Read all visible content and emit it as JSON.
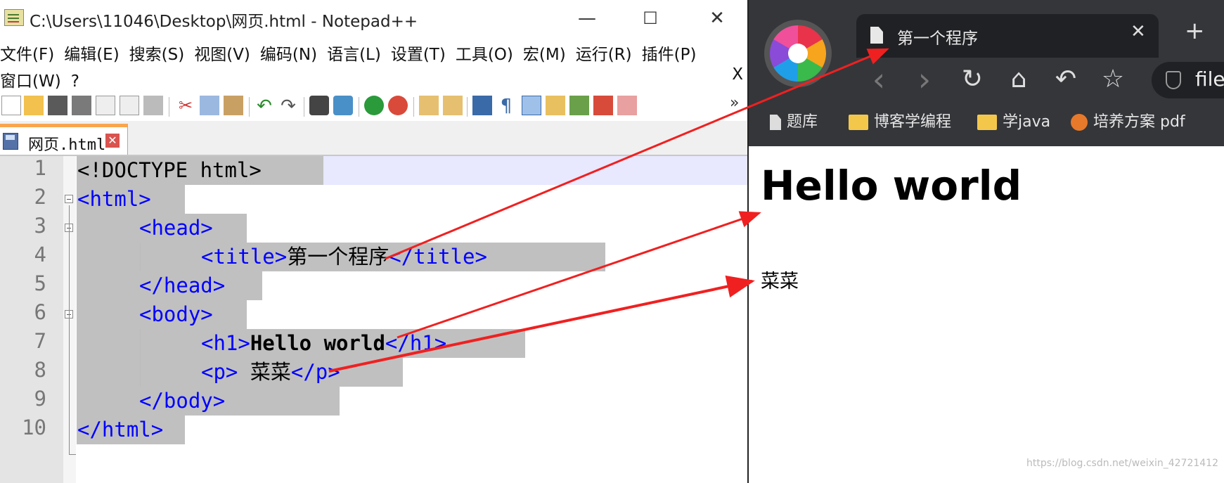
{
  "notepad": {
    "window_title": "C:\\Users\\11046\\Desktop\\网页.html - Notepad++",
    "window_controls": {
      "minimize": "—",
      "maximize": "☐",
      "close": "✕"
    },
    "menu_row1": [
      "文件(F)",
      "编辑(E)",
      "搜索(S)",
      "视图(V)",
      "编码(N)",
      "语言(L)",
      "设置(T)",
      "工具(O)",
      "宏(M)",
      "运行(R)",
      "插件(P)"
    ],
    "menu_row2": [
      "窗口(W)",
      "?"
    ],
    "menu_close": "X",
    "toolbar_overflow": "»",
    "tab": {
      "label": "网页.html",
      "close": "✕"
    },
    "line_numbers": [
      "1",
      "2",
      "3",
      "4",
      "5",
      "6",
      "7",
      "8",
      "9",
      "10"
    ],
    "code": {
      "l1": "<!DOCTYPE html>",
      "l2": "<html>",
      "l3_open": "<head>",
      "l4_open": "<title>",
      "l4_text": "第一个程序",
      "l4_close": "</title>",
      "l5": "</head>",
      "l6": "<body>",
      "l7_open": "<h1>",
      "l7_text": "Hello world",
      "l7_close": "</h1>",
      "l8_open": "<p>",
      "l8_text": " 菜菜",
      "l8_close": "</p>",
      "l9": "</body>",
      "l10": "</html>"
    },
    "colors": {
      "tag": "#0000ff",
      "selection": "#c0c0c0",
      "tab_accent": "#f9a54e"
    }
  },
  "browser": {
    "tab_title": "第一个程序",
    "tab_close": "✕",
    "new_tab": "+",
    "nav": {
      "back": "‹",
      "forward": "›",
      "reload": "↻",
      "home": "⌂",
      "undo": "↶",
      "star": "☆"
    },
    "url": "file",
    "bookmarks": [
      "题库",
      "博客学编程",
      "学java",
      "培养方案 pdf"
    ],
    "page": {
      "h1": "Hello world",
      "p": "菜菜"
    },
    "watermark": "https://blog.csdn.net/weixin_42721412",
    "colors": {
      "chrome": "#35363a",
      "tab": "#202124",
      "folder": "#f3c84a"
    }
  },
  "annotation_arrow_color": "#f02020"
}
